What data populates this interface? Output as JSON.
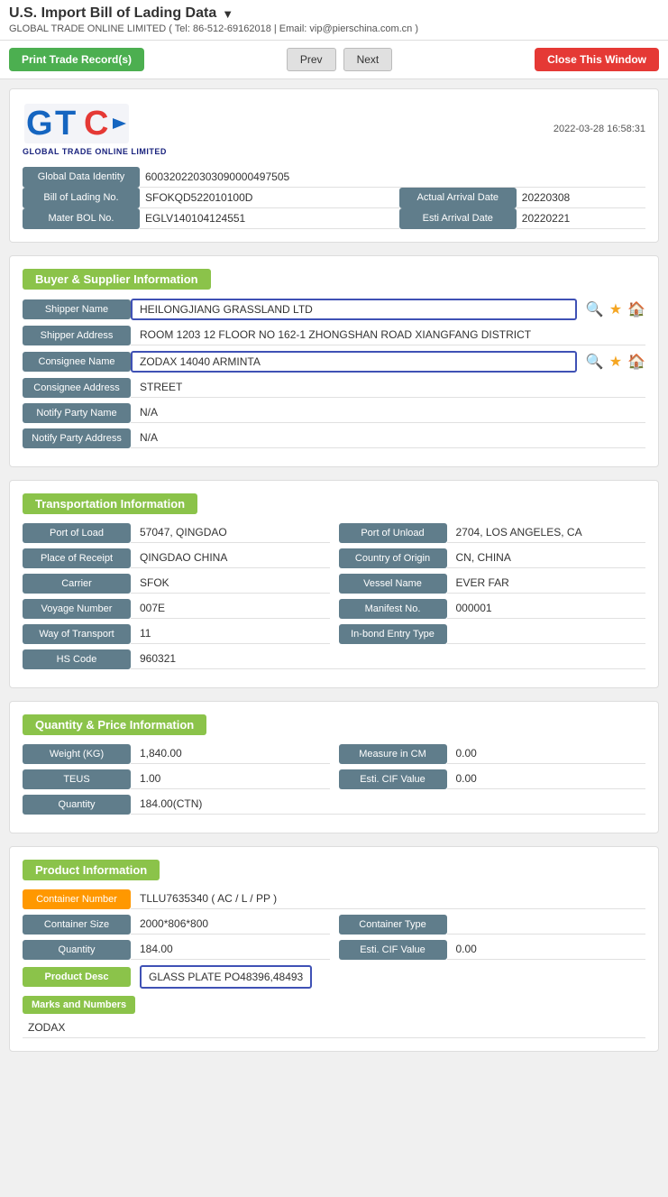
{
  "page": {
    "title": "U.S. Import Bill of Lading Data",
    "subtitle": "GLOBAL TRADE ONLINE LIMITED ( Tel: 86-512-69162018 | Email: vip@pierschina.com.cn )",
    "timestamp": "2022-03-28 16:58:31"
  },
  "toolbar": {
    "print_label": "Print Trade Record(s)",
    "prev_label": "Prev",
    "next_label": "Next",
    "close_label": "Close This Window"
  },
  "identity": {
    "global_data_identity_label": "Global Data Identity",
    "global_data_identity_value": "600320220303090000497505",
    "bill_of_lading_label": "Bill of Lading No.",
    "bill_of_lading_value": "SFOKQD522010100D",
    "actual_arrival_label": "Actual Arrival Date",
    "actual_arrival_value": "20220308",
    "mater_bol_label": "Mater BOL No.",
    "mater_bol_value": "EGLV140104124551",
    "esti_arrival_label": "Esti Arrival Date",
    "esti_arrival_value": "20220221"
  },
  "buyer_supplier": {
    "section_title": "Buyer & Supplier Information",
    "shipper_name_label": "Shipper Name",
    "shipper_name_value": "HEILONGJIANG GRASSLAND LTD",
    "shipper_address_label": "Shipper Address",
    "shipper_address_value": "ROOM 1203 12 FLOOR NO 162-1 ZHONGSHAN ROAD XIANGFANG DISTRICT",
    "consignee_name_label": "Consignee Name",
    "consignee_name_value": "ZODAX 14040 ARMINTA",
    "consignee_address_label": "Consignee Address",
    "consignee_address_value": "STREET",
    "notify_party_name_label": "Notify Party Name",
    "notify_party_name_value": "N/A",
    "notify_party_address_label": "Notify Party Address",
    "notify_party_address_value": "N/A"
  },
  "transportation": {
    "section_title": "Transportation Information",
    "port_of_load_label": "Port of Load",
    "port_of_load_value": "57047, QINGDAO",
    "port_of_unload_label": "Port of Unload",
    "port_of_unload_value": "2704, LOS ANGELES, CA",
    "place_of_receipt_label": "Place of Receipt",
    "place_of_receipt_value": "QINGDAO CHINA",
    "country_of_origin_label": "Country of Origin",
    "country_of_origin_value": "CN, CHINA",
    "carrier_label": "Carrier",
    "carrier_value": "SFOK",
    "vessel_name_label": "Vessel Name",
    "vessel_name_value": "EVER FAR",
    "voyage_number_label": "Voyage Number",
    "voyage_number_value": "007E",
    "manifest_no_label": "Manifest No.",
    "manifest_no_value": "000001",
    "way_of_transport_label": "Way of Transport",
    "way_of_transport_value": "11",
    "in_bond_entry_label": "In-bond Entry Type",
    "in_bond_entry_value": "",
    "hs_code_label": "HS Code",
    "hs_code_value": "960321"
  },
  "quantity_price": {
    "section_title": "Quantity & Price Information",
    "weight_label": "Weight (KG)",
    "weight_value": "1,840.00",
    "measure_in_cm_label": "Measure in CM",
    "measure_in_cm_value": "0.00",
    "teus_label": "TEUS",
    "teus_value": "1.00",
    "esti_cif_label": "Esti. CIF Value",
    "esti_cif_value": "0.00",
    "quantity_label": "Quantity",
    "quantity_value": "184.00(CTN)"
  },
  "product": {
    "section_title": "Product Information",
    "container_number_label": "Container Number",
    "container_number_value": "TLLU7635340 ( AC / L / PP )",
    "container_size_label": "Container Size",
    "container_size_value": "2000*806*800",
    "container_type_label": "Container Type",
    "container_type_value": "",
    "quantity_label": "Quantity",
    "quantity_value": "184.00",
    "esti_cif_label": "Esti. CIF Value",
    "esti_cif_value": "0.00",
    "product_desc_label": "Product Desc",
    "product_desc_value": "GLASS PLATE PO48396,48493",
    "marks_label": "Marks and Numbers",
    "marks_value": "ZODAX"
  },
  "icons": {
    "search": "🔍",
    "star": "★",
    "home": "🏠",
    "dropdown": "▼"
  }
}
